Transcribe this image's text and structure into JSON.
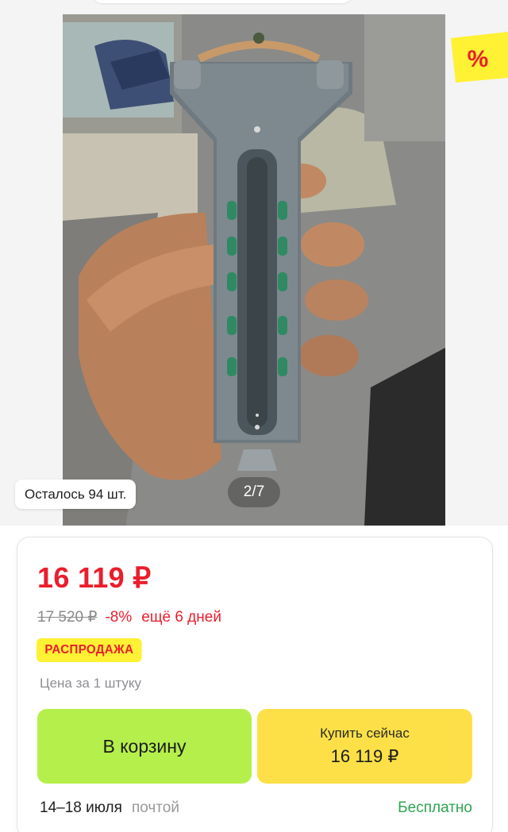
{
  "gallery": {
    "stock_label": "Осталось 94 шт.",
    "counter": "2/7",
    "sale_sticker": "%",
    "photo_subject": "metal-slingshot-in-hand"
  },
  "product": {
    "price": "16 119 ₽",
    "old_price": "17 520 ₽",
    "discount": "-8%",
    "days_left": "ещё 6 дней",
    "badge": "РАСПРОДАЖА",
    "unit_note": "Цена за 1 штуку"
  },
  "actions": {
    "cart_label": "В корзину",
    "buy_label": "Купить сейчас",
    "buy_price": "16 119 ₽"
  },
  "delivery": {
    "dates": "14–18 июля",
    "method": "почтой",
    "price": "Бесплатно"
  },
  "colors": {
    "price_red": "#ea1e2c",
    "cart_green": "#b5ef4b",
    "buy_yellow": "#fde047",
    "badge_yellow": "#fff134",
    "free_green": "#2ea44f"
  }
}
